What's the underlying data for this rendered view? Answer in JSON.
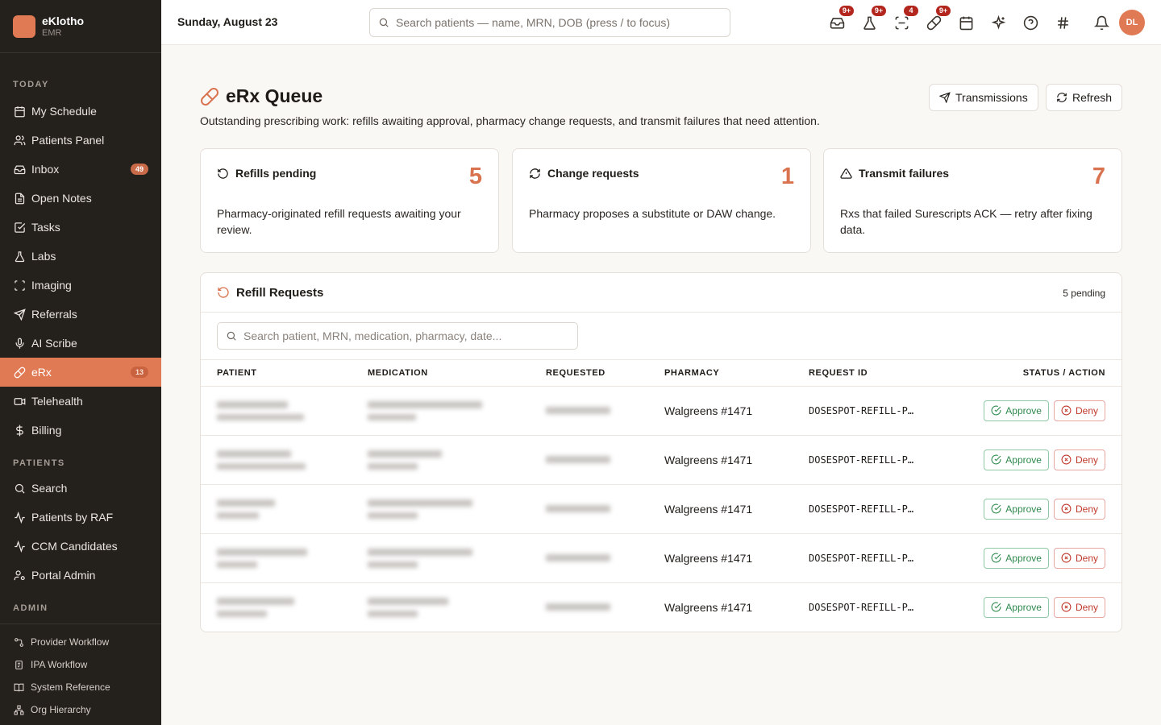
{
  "brand": {
    "name": "eKlotho",
    "sub": "EMR"
  },
  "sidebar": {
    "sections": [
      {
        "title": "TODAY",
        "items": [
          {
            "label": "My Schedule",
            "icon": "calendar-icon"
          },
          {
            "label": "Patients Panel",
            "icon": "users-icon"
          },
          {
            "label": "Inbox",
            "icon": "inbox-icon",
            "badge": "49"
          },
          {
            "label": "Open Notes",
            "icon": "notes-icon"
          },
          {
            "label": "Tasks",
            "icon": "tasks-icon"
          },
          {
            "label": "Labs",
            "icon": "flask-icon"
          },
          {
            "label": "Imaging",
            "icon": "scan-icon"
          },
          {
            "label": "Referrals",
            "icon": "send-icon"
          },
          {
            "label": "AI Scribe",
            "icon": "mic-icon"
          },
          {
            "label": "eRx",
            "icon": "pill-icon",
            "badge": "13",
            "active": true
          },
          {
            "label": "Telehealth",
            "icon": "video-icon"
          },
          {
            "label": "Billing",
            "icon": "dollar-icon"
          }
        ]
      },
      {
        "title": "PATIENTS",
        "items": [
          {
            "label": "Search",
            "icon": "search-icon"
          },
          {
            "label": "Patients by RAF",
            "icon": "activity-icon"
          },
          {
            "label": "CCM Candidates",
            "icon": "activity-icon"
          },
          {
            "label": "Portal Admin",
            "icon": "user-cog-icon"
          }
        ]
      },
      {
        "title": "ADMIN",
        "items": []
      }
    ],
    "admin_items": [
      {
        "label": "Provider Workflow",
        "icon": "workflow-icon"
      },
      {
        "label": "IPA Workflow",
        "icon": "clipboard-icon"
      },
      {
        "label": "System Reference",
        "icon": "book-icon"
      },
      {
        "label": "Org Hierarchy",
        "icon": "hierarchy-icon"
      }
    ]
  },
  "topbar": {
    "date": "Sunday, August 23",
    "search_placeholder": "Search patients — name, MRN, DOB (press / to focus)",
    "icons": [
      {
        "name": "inbox-icon",
        "badge": "9+"
      },
      {
        "name": "flask-icon",
        "badge": "9+"
      },
      {
        "name": "scan-icon",
        "badge": "4"
      },
      {
        "name": "pill-icon",
        "badge": "9+"
      },
      {
        "name": "calendar-icon",
        "badge": ""
      },
      {
        "name": "sparkles-icon",
        "badge": ""
      },
      {
        "name": "help-icon",
        "badge": ""
      },
      {
        "name": "hash-icon",
        "badge": ""
      },
      {
        "name": "bell-icon",
        "badge": ""
      }
    ],
    "avatar": "DL"
  },
  "page": {
    "title": "eRx Queue",
    "description": "Outstanding prescribing work: refills awaiting approval, pharmacy change requests, and transmit failures that need attention.",
    "buttons": {
      "transmissions": "Transmissions",
      "refresh": "Refresh"
    }
  },
  "cards": [
    {
      "title": "Refills pending",
      "count": "5",
      "icon": "refresh-ccw-icon",
      "desc": "Pharmacy-originated refill requests awaiting your review."
    },
    {
      "title": "Change requests",
      "count": "1",
      "icon": "repeat-icon",
      "desc": "Pharmacy proposes a substitute or DAW change."
    },
    {
      "title": "Transmit failures",
      "count": "7",
      "icon": "alert-triangle-icon",
      "desc": "Rxs that failed Surescripts ACK — retry after fixing data."
    }
  ],
  "refills": {
    "title": "Refill Requests",
    "count_label": "5 pending",
    "search_placeholder": "Search patient, MRN, medication, pharmacy, date...",
    "columns": [
      "PATIENT",
      "MEDICATION",
      "REQUESTED",
      "PHARMACY",
      "REQUEST ID",
      "STATUS / ACTION"
    ],
    "rows": [
      {
        "pharmacy": "Walgreens #1471",
        "request_id": "DOSESPOT-REFILL-P…"
      },
      {
        "pharmacy": "Walgreens #1471",
        "request_id": "DOSESPOT-REFILL-P…"
      },
      {
        "pharmacy": "Walgreens #1471",
        "request_id": "DOSESPOT-REFILL-P…"
      },
      {
        "pharmacy": "Walgreens #1471",
        "request_id": "DOSESPOT-REFILL-P…"
      },
      {
        "pharmacy": "Walgreens #1471",
        "request_id": "DOSESPOT-REFILL-P…"
      }
    ],
    "approve_label": "Approve",
    "deny_label": "Deny"
  }
}
